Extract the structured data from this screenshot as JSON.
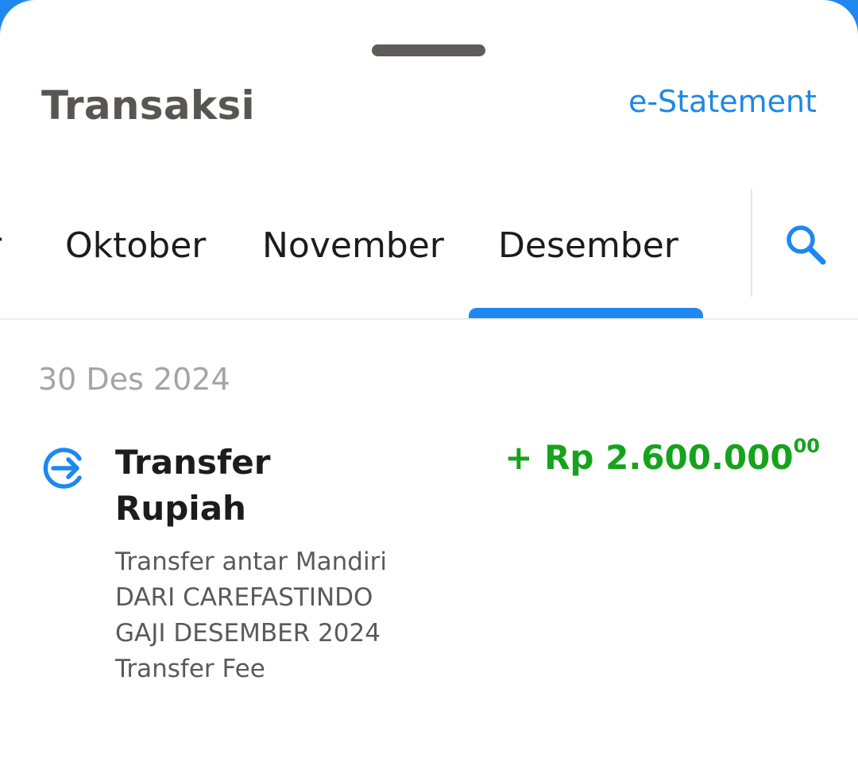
{
  "header": {
    "title": "Transaksi",
    "estatement_label": "e-Statement"
  },
  "tabs": {
    "partial_label": "r",
    "items": [
      "Oktober",
      "November",
      "Desember"
    ],
    "selected": "Desember"
  },
  "search": {
    "icon": "search-icon"
  },
  "transactions": {
    "date": "30 Des 2024",
    "items": [
      {
        "icon": "transfer-in-icon",
        "title": "Transfer Rupiah",
        "description_lines": [
          "Transfer antar Mandiri",
          "DARI CAREFASTINDO",
          "GAJI DESEMBER 2024",
          "Transfer Fee"
        ],
        "amount_main": "+ Rp 2.600.000",
        "amount_cents": "00"
      }
    ]
  },
  "colors": {
    "accent": "#1e88f0",
    "credit": "#16a31c",
    "title": "#5a5555"
  }
}
